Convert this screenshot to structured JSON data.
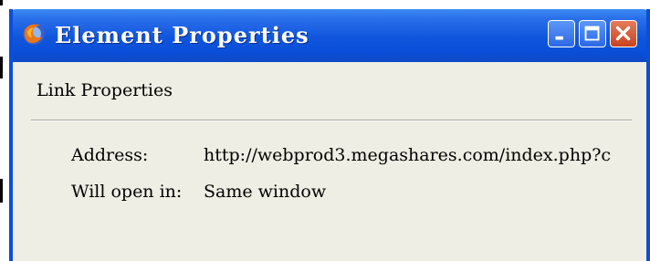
{
  "window": {
    "title": "Element Properties",
    "icon": "firefox-icon",
    "controls": {
      "minimize": "minimize-icon",
      "maximize": "maximize-icon",
      "close": "close-icon"
    }
  },
  "section": {
    "heading": "Link Properties"
  },
  "properties": [
    {
      "label": "Address:",
      "value": "http://webprod3.megashares.com/index.php?c"
    },
    {
      "label": "Will open in:",
      "value": "Same window"
    }
  ],
  "colors": {
    "titlebar": "#0a4fd9",
    "window_body": "#efeee4",
    "close_button": "#c9431f"
  }
}
